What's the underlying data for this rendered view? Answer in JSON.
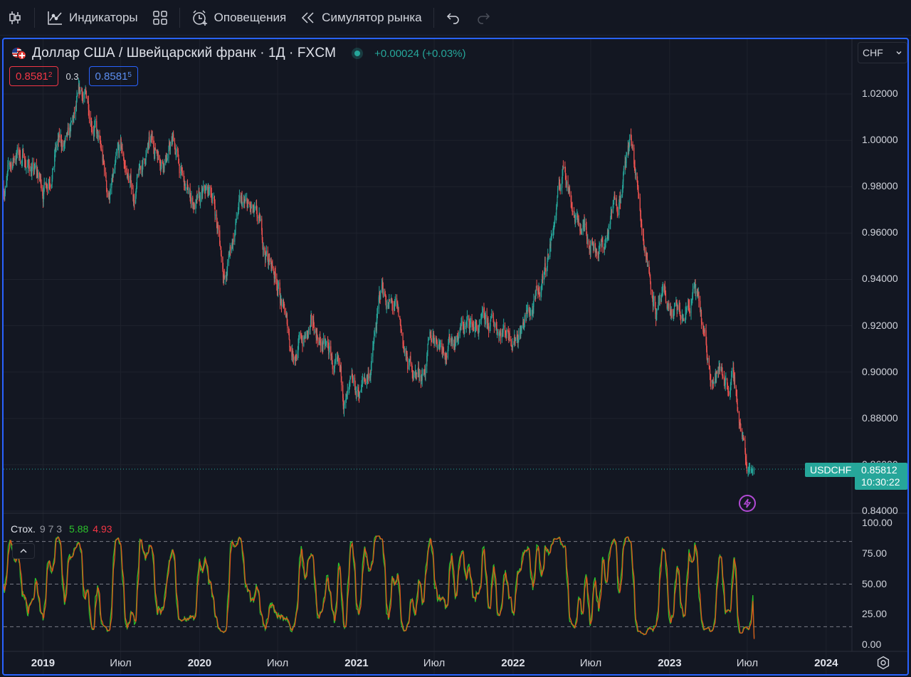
{
  "toolbar": {
    "indicators_label": "Индикаторы",
    "alerts_label": "Оповещения",
    "replay_label": "Симулятор рынка"
  },
  "header": {
    "title": "Доллар США / Швейцарский франк · 1Д · FXCM",
    "change": "+0.00024 (+0.03%)",
    "sell_price_main": "0.8581",
    "sell_price_sup": "2",
    "spread": "0.3",
    "buy_price_main": "0.8581",
    "buy_price_sup": "5",
    "currency": "CHF"
  },
  "price_scale": {
    "labels": [
      "1.02000",
      "1.00000",
      "0.98000",
      "0.96000",
      "0.94000",
      "0.92000",
      "0.90000",
      "0.88000",
      "0.86000",
      "0.84000"
    ],
    "symbol_tag": "USDCHF",
    "last_price": "0.85812",
    "countdown": "10:30:22"
  },
  "oscillator": {
    "name": "Стох.",
    "params": "9 7 3",
    "k_value": "5.88",
    "d_value": "4.93",
    "scale_labels": [
      "100.00",
      "75.00",
      "50.00",
      "25.00",
      "0.00"
    ]
  },
  "time_axis": [
    {
      "label": "2019",
      "year": true
    },
    {
      "label": "Июл",
      "year": false
    },
    {
      "label": "2020",
      "year": true
    },
    {
      "label": "Июл",
      "year": false
    },
    {
      "label": "2021",
      "year": true
    },
    {
      "label": "Июл",
      "year": false
    },
    {
      "label": "2022",
      "year": true
    },
    {
      "label": "Июл",
      "year": false
    },
    {
      "label": "2023",
      "year": true
    },
    {
      "label": "Июл",
      "year": false
    },
    {
      "label": "2024",
      "year": true
    }
  ],
  "colors": {
    "up": "#26a69a",
    "down": "#ef5350",
    "k_line": "#2cc12c",
    "d_line": "#e0541a",
    "accent": "#2962ff"
  },
  "chart_data": {
    "type": "candlestick",
    "symbol": "USDCHF",
    "timeframe": "1D",
    "ylim": [
      0.84,
      1.02
    ],
    "price_path": [
      [
        "2018-10-01",
        0.98
      ],
      [
        "2018-11-01",
        0.995
      ],
      [
        "2018-12-01",
        0.99
      ],
      [
        "2019-01-01",
        0.978
      ],
      [
        "2019-02-01",
        1.0
      ],
      [
        "2019-03-01",
        0.995
      ],
      [
        "2019-04-01",
        1.015
      ],
      [
        "2019-05-01",
        1.01
      ],
      [
        "2019-06-01",
        0.975
      ],
      [
        "2019-07-01",
        0.99
      ],
      [
        "2019-08-01",
        0.975
      ],
      [
        "2019-09-01",
        0.995
      ],
      [
        "2019-10-01",
        0.995
      ],
      [
        "2019-11-01",
        1.0
      ],
      [
        "2019-12-01",
        0.975
      ],
      [
        "2020-01-01",
        0.97
      ],
      [
        "2020-02-01",
        0.975
      ],
      [
        "2020-03-01",
        0.94
      ],
      [
        "2020-04-01",
        0.97
      ],
      [
        "2020-05-01",
        0.965
      ],
      [
        "2020-06-01",
        0.95
      ],
      [
        "2020-07-01",
        0.94
      ],
      [
        "2020-08-01",
        0.91
      ],
      [
        "2020-09-01",
        0.915
      ],
      [
        "2020-10-01",
        0.915
      ],
      [
        "2020-11-01",
        0.905
      ],
      [
        "2020-12-01",
        0.885
      ],
      [
        "2021-01-01",
        0.885
      ],
      [
        "2021-02-01",
        0.9
      ],
      [
        "2021-03-01",
        0.935
      ],
      [
        "2021-04-01",
        0.925
      ],
      [
        "2021-05-01",
        0.9
      ],
      [
        "2021-06-01",
        0.9
      ],
      [
        "2021-07-01",
        0.915
      ],
      [
        "2021-08-01",
        0.915
      ],
      [
        "2021-09-01",
        0.92
      ],
      [
        "2021-10-01",
        0.92
      ],
      [
        "2021-11-01",
        0.915
      ],
      [
        "2021-12-01",
        0.92
      ],
      [
        "2022-01-01",
        0.92
      ],
      [
        "2022-02-01",
        0.925
      ],
      [
        "2022-03-01",
        0.93
      ],
      [
        "2022-04-01",
        0.96
      ],
      [
        "2022-05-01",
        0.99
      ],
      [
        "2022-06-01",
        0.965
      ],
      [
        "2022-07-01",
        0.96
      ],
      [
        "2022-08-01",
        0.955
      ],
      [
        "2022-09-01",
        0.975
      ],
      [
        "2022-10-01",
        1.0
      ],
      [
        "2022-11-01",
        0.96
      ],
      [
        "2022-12-01",
        0.93
      ],
      [
        "2023-01-01",
        0.925
      ],
      [
        "2023-02-01",
        0.92
      ],
      [
        "2023-03-01",
        0.935
      ],
      [
        "2023-04-01",
        0.9
      ],
      [
        "2023-05-01",
        0.9
      ],
      [
        "2023-06-01",
        0.895
      ],
      [
        "2023-07-01",
        0.858
      ]
    ],
    "oscillator": {
      "type": "stochastic",
      "params": [
        9,
        7,
        3
      ],
      "levels": [
        85,
        50,
        15
      ],
      "ylim": [
        0,
        100
      ],
      "last_k": 5.88,
      "last_d": 4.93
    }
  }
}
